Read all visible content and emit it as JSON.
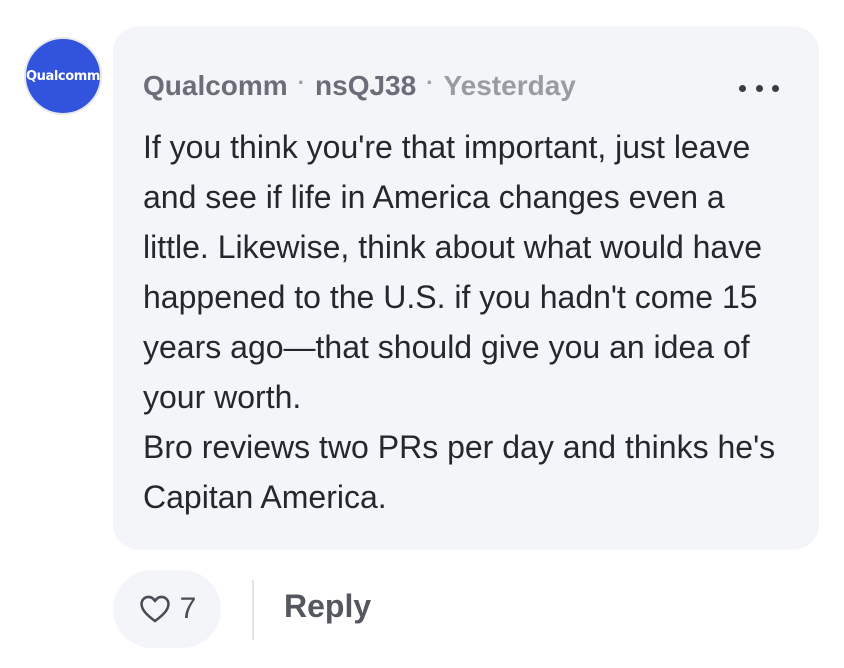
{
  "comment": {
    "avatar_logo_text": "Qualcomm",
    "author_org": "Qualcomm",
    "username": "nsQJ38",
    "separator": "·",
    "timestamp": "Yesterday",
    "body_paragraphs": [
      "If you think you're that important, just leave and see if life in America changes even a little. Likewise, think about what would have happened to the U.S. if you hadn't come 15 years ago—that should give you an idea of your worth.",
      "Bro reviews two PRs per day and thinks he's Capitan America."
    ]
  },
  "actions": {
    "like_icon": "heart-outline-icon",
    "like_count": "7",
    "reply_label": "Reply",
    "more_icon": "ellipsis-icon"
  },
  "colors": {
    "avatar_bg": "#3253dc",
    "bubble_bg": "#f4f5f9"
  }
}
